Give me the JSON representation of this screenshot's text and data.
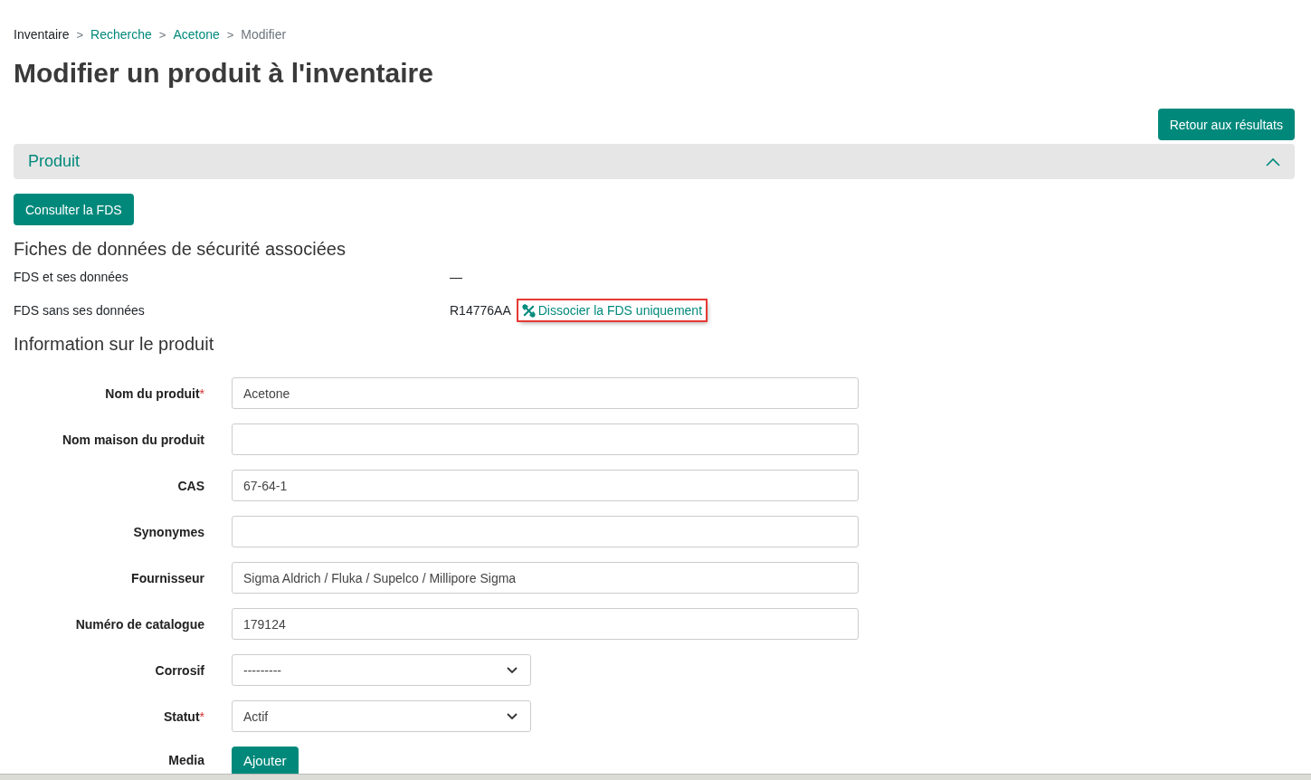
{
  "breadcrumb": [
    {
      "label": "Inventaire",
      "kind": "plain"
    },
    {
      "label": "Recherche",
      "kind": "link"
    },
    {
      "label": "Acetone",
      "kind": "link"
    },
    {
      "label": "Modifier",
      "kind": "current"
    }
  ],
  "separator": ">",
  "title": "Modifier un produit à l'inventaire",
  "required_mark": "*",
  "back_button": "Retour aux résultats",
  "section": {
    "title": "Produit",
    "expanded": true
  },
  "consult_button": "Consulter la FDS",
  "sds_heading": "Fiches de données de sécurité associées",
  "sds_rows": [
    {
      "label": "FDS et ses données",
      "value": "—"
    },
    {
      "label": "FDS sans ses données",
      "value": "R14776AA",
      "action": "Dissocier la FDS uniquement",
      "highlighted": true
    }
  ],
  "info_heading": "Information sur le produit",
  "fields": [
    {
      "kind": "text",
      "label": "Nom du produit",
      "required": true,
      "value": "Acetone"
    },
    {
      "kind": "text",
      "label": "Nom maison du produit",
      "required": false
    },
    {
      "kind": "text",
      "label": "CAS",
      "required": false,
      "value": "67-64-1"
    },
    {
      "kind": "text",
      "label": "Synonymes",
      "required": false
    },
    {
      "kind": "text",
      "label": "Fournisseur",
      "required": false,
      "value": "Sigma Aldrich / Fluka / Supelco / Millipore Sigma"
    },
    {
      "kind": "text",
      "label": "Numéro de catalogue",
      "required": false,
      "value": "179124"
    },
    {
      "kind": "select",
      "label": "Corrosif",
      "required": false,
      "value": "---------"
    },
    {
      "kind": "select",
      "label": "Statut",
      "required": true,
      "value": "Actif"
    },
    {
      "kind": "button",
      "label": "Media",
      "required": false,
      "value": "Ajouter"
    }
  ]
}
